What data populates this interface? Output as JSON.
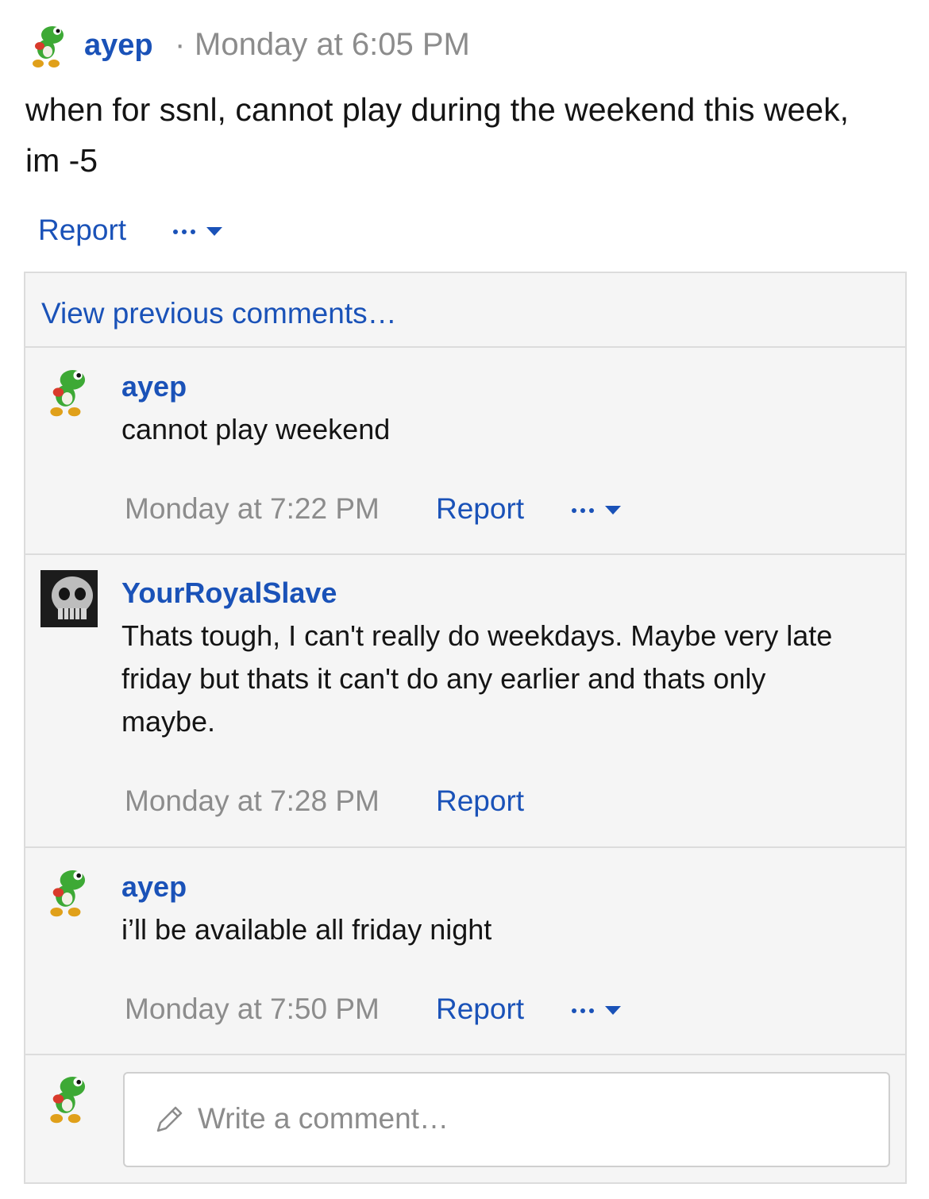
{
  "post": {
    "author": "ayep",
    "separator": "·",
    "time": "Monday at 6:05 PM",
    "text": "when for ssnl, cannot play during the weekend this week, im -5",
    "actions": {
      "report": "Report"
    }
  },
  "comments_panel": {
    "view_previous": "View previous comments…",
    "comments": [
      {
        "author": "ayep",
        "text": "cannot play weekend",
        "time": "Monday at 7:22 PM",
        "report": "Report"
      },
      {
        "author": "YourRoyalSlave",
        "text": "Thats tough, I can't really do weekdays. Maybe very late friday but thats it can't do any earlier and thats only maybe.",
        "time": "Monday at 7:28 PM",
        "report": "Report"
      },
      {
        "author": "ayep",
        "text": "i’ll be available all friday night",
        "time": "Monday at 7:50 PM",
        "report": "Report"
      }
    ],
    "composer": {
      "placeholder": "Write a comment…"
    }
  },
  "colors": {
    "link": "#1a52b8",
    "muted": "#8c8c8c",
    "panel_bg": "#f5f5f5",
    "border": "#dcdcdc"
  }
}
